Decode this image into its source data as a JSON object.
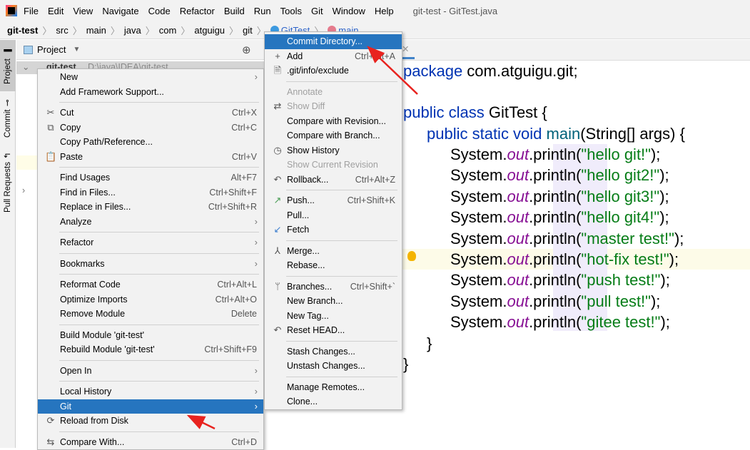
{
  "menubar": {
    "items": [
      "File",
      "Edit",
      "View",
      "Navigate",
      "Code",
      "Refactor",
      "Build",
      "Run",
      "Tools",
      "Git",
      "Window",
      "Help"
    ],
    "window_title": "git-test - GitTest.java"
  },
  "breadcrumb": {
    "items": [
      "git-test",
      "src",
      "main",
      "java",
      "com",
      "atguigu",
      "git"
    ],
    "class_name": "GitTest",
    "method_name": "main"
  },
  "sidebar_tabs": {
    "project": "Project",
    "commit": "Commit",
    "pull_requests": "Pull Requests"
  },
  "project_panel": {
    "title": "Project",
    "root": "git-test",
    "root_path": "D:\\java\\IDEA\\git-test"
  },
  "context_menu": [
    {
      "label": "New",
      "submenu": true
    },
    {
      "label": "Add Framework Support..."
    },
    {
      "sep": true
    },
    {
      "label": "Cut",
      "shortcut": "Ctrl+X",
      "icon": "scissors-icon",
      "glyph": "✂"
    },
    {
      "label": "Copy",
      "shortcut": "Ctrl+C",
      "icon": "copy-icon",
      "glyph": "⧉"
    },
    {
      "label": "Copy Path/Reference..."
    },
    {
      "label": "Paste",
      "shortcut": "Ctrl+V",
      "icon": "clipboard-icon",
      "glyph": "📋"
    },
    {
      "sep": true
    },
    {
      "label": "Find Usages",
      "shortcut": "Alt+F7"
    },
    {
      "label": "Find in Files...",
      "shortcut": "Ctrl+Shift+F"
    },
    {
      "label": "Replace in Files...",
      "shortcut": "Ctrl+Shift+R"
    },
    {
      "label": "Analyze",
      "submenu": true
    },
    {
      "sep": true
    },
    {
      "label": "Refactor",
      "submenu": true
    },
    {
      "sep": true
    },
    {
      "label": "Bookmarks",
      "submenu": true
    },
    {
      "sep": true
    },
    {
      "label": "Reformat Code",
      "shortcut": "Ctrl+Alt+L"
    },
    {
      "label": "Optimize Imports",
      "shortcut": "Ctrl+Alt+O"
    },
    {
      "label": "Remove Module",
      "shortcut": "Delete"
    },
    {
      "sep": true
    },
    {
      "label": "Build Module 'git-test'"
    },
    {
      "label": "Rebuild Module 'git-test'",
      "shortcut": "Ctrl+Shift+F9"
    },
    {
      "sep": true
    },
    {
      "label": "Open In",
      "submenu": true
    },
    {
      "sep": true
    },
    {
      "label": "Local History",
      "submenu": true
    },
    {
      "label": "Git",
      "submenu": true,
      "selected": true
    },
    {
      "label": "Reload from Disk",
      "icon": "reload-icon",
      "glyph": "⟳"
    },
    {
      "sep": true
    },
    {
      "label": "Compare With...",
      "shortcut": "Ctrl+D",
      "icon": "compare-icon",
      "glyph": "⇆"
    }
  ],
  "git_submenu": [
    {
      "label": "Commit Directory...",
      "selected": true
    },
    {
      "label": "Add",
      "shortcut": "Ctrl+Alt+A",
      "icon": "plus-icon",
      "glyph": "+"
    },
    {
      "label": ".git/info/exclude",
      "icon": "file-ignore-icon",
      "glyph": "🗎"
    },
    {
      "sep": true
    },
    {
      "label": "Annotate",
      "disabled": true
    },
    {
      "label": "Show Diff",
      "disabled": true,
      "icon": "diff-icon",
      "glyph": "⇄"
    },
    {
      "label": "Compare with Revision..."
    },
    {
      "label": "Compare with Branch..."
    },
    {
      "label": "Show History",
      "icon": "clock-icon",
      "glyph": "◷"
    },
    {
      "label": "Show Current Revision",
      "disabled": true
    },
    {
      "label": "Rollback...",
      "shortcut": "Ctrl+Alt+Z",
      "icon": "undo-icon",
      "glyph": "↶"
    },
    {
      "sep": true
    },
    {
      "label": "Push...",
      "shortcut": "Ctrl+Shift+K",
      "icon": "push-arrow-icon",
      "glyph": "↗",
      "color": "#499c54"
    },
    {
      "label": "Pull..."
    },
    {
      "label": "Fetch",
      "icon": "fetch-icon",
      "glyph": "↙",
      "color": "#3d7fcf"
    },
    {
      "sep": true
    },
    {
      "label": "Merge...",
      "icon": "merge-icon",
      "glyph": "⅄"
    },
    {
      "label": "Rebase..."
    },
    {
      "sep": true
    },
    {
      "label": "Branches...",
      "shortcut": "Ctrl+Shift+`",
      "icon": "branch-icon",
      "glyph": "ᛘ"
    },
    {
      "label": "New Branch..."
    },
    {
      "label": "New Tag..."
    },
    {
      "label": "Reset HEAD...",
      "icon": "reset-icon",
      "glyph": "↶"
    },
    {
      "sep": true
    },
    {
      "label": "Stash Changes..."
    },
    {
      "label": "Unstash Changes..."
    },
    {
      "sep": true
    },
    {
      "label": "Manage Remotes..."
    },
    {
      "label": "Clone..."
    }
  ],
  "code": {
    "package_kw": "package",
    "package_name": " com.atguigu.git;",
    "class_decl": [
      "public class",
      " GitTest {"
    ],
    "main_decl": [
      "public static void",
      " main",
      "(String[] args) {"
    ],
    "prints": [
      "hello git!",
      "hello git2!",
      "hello git3!",
      "hello git4!",
      "master test!",
      "hot-fix test!",
      "push test!",
      "pull test!",
      "gitee test!"
    ],
    "close1": "}",
    "close2": "}"
  },
  "colors": {
    "selection": "#2675bf",
    "annotation_arrow": "#e8231f",
    "keyword": "#0033b3",
    "string": "#067d17"
  }
}
